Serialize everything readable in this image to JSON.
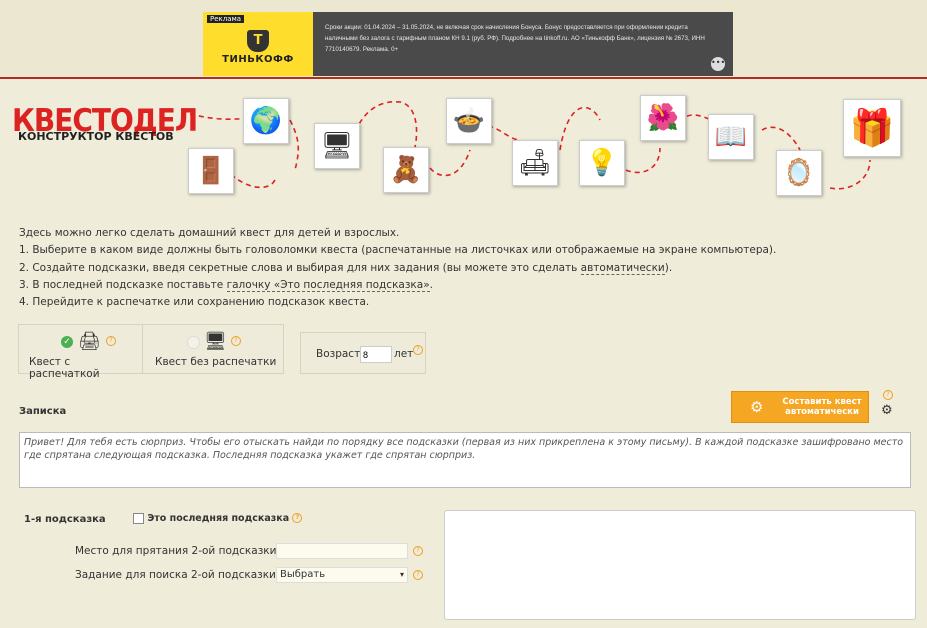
{
  "ad": {
    "tag": "Реклама",
    "brand": "ТИНЬКОФФ",
    "logo_letter": "Т",
    "text": "Сроки акции: 01.04.2024 – 31.05.2024, не включая срок начисления Бонуса. Бонус предоставляется при оформлении кредита наличными без залога с тарифным планом КН 9.1 (руб. РФ). Подробнее на tinkoff.ru. АО «Тинькофф Банк», лицензия № 2673, ИНН 7710140679. Реклама. 0+",
    "more": "•••"
  },
  "logo": {
    "title": "КВЕСТОДЕЛ",
    "subtitle": "КОНСТРУКТОР КВЕСТОВ"
  },
  "items": [
    {
      "icon": "wardrobe-icon",
      "glyph": "🚪"
    },
    {
      "icon": "globe-icon",
      "glyph": "🌍"
    },
    {
      "icon": "tv-icon",
      "glyph": "🖥"
    },
    {
      "icon": "toybox-icon",
      "glyph": "🧸"
    },
    {
      "icon": "pot-icon",
      "glyph": "🍲"
    },
    {
      "icon": "armchair-icon",
      "glyph": "🛋"
    },
    {
      "icon": "lamp-icon",
      "glyph": "🛋"
    },
    {
      "icon": "flowerpot-icon",
      "glyph": "🌺"
    },
    {
      "icon": "book-icon",
      "glyph": "📖"
    },
    {
      "icon": "mirror-icon",
      "glyph": "🪞"
    },
    {
      "icon": "gift-icon",
      "glyph": "🎁"
    }
  ],
  "intro": {
    "line0": "Здесь можно легко сделать домашний квест для детей и взрослых.",
    "line1": "1. Выберите в каком виде должны быть головоломки квеста (распечатанные на листочках или отображаемые на экране компьютера).",
    "line2a": "2. Создайте подсказки, введя секретные слова и выбирая для них задания (вы можете это сделать ",
    "line2link": "автоматически",
    "line2b": ").",
    "line3a": "3. В последней подсказке поставьте ",
    "line3link": "галочку «Это последняя подсказка»",
    "line3b": ".",
    "line4": "4. Перейдите к распечатке или сохранению подсказок квеста."
  },
  "modes": {
    "print_label": "Квест с распечаткой",
    "noprint_label": "Квест без распечатки",
    "age_label": "Возраст:",
    "age_value": "8",
    "age_unit": "лет"
  },
  "note": {
    "label": "Записка",
    "auto_button": "Составить квест автоматически",
    "text": "Привет! Для тебя есть сюрприз. Чтобы его отыскать найди по порядку все подсказки (первая из них прикреплена к этому письму). В каждой подсказке зашифровано место где спрятана следующая подсказка. Последняя подсказка укажет где спрятан сюрприз."
  },
  "hint": {
    "title": "1-я подсказка",
    "last_label": "Это последняя подсказка",
    "place_label": "Место для прятания 2-ой подсказки:",
    "place_value": "",
    "task_label": "Задание для поиска 2-ой подсказки:",
    "task_value": "Выбрать"
  },
  "colors": {
    "accent": "#f5a623",
    "brand_red": "#d22222",
    "ad_yellow": "#ffdd2d"
  }
}
